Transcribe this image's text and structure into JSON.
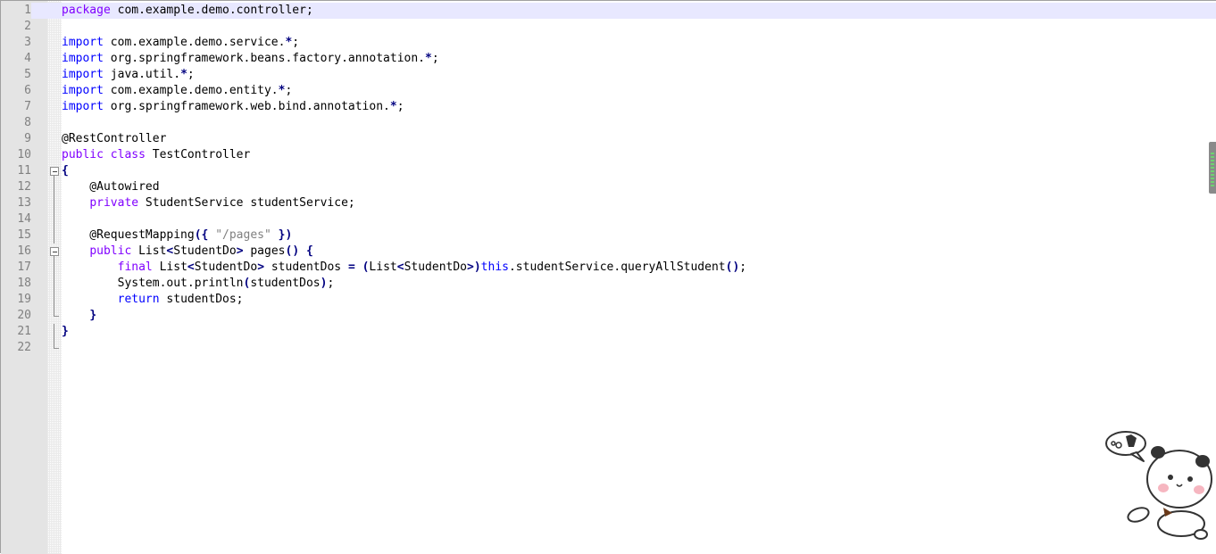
{
  "editor": {
    "lines": [
      {
        "n": "1",
        "tokens": [
          {
            "c": "kw",
            "t": "package"
          },
          {
            "c": "",
            "t": " com.example.demo.controller;"
          }
        ]
      },
      {
        "n": "2",
        "tokens": []
      },
      {
        "n": "3",
        "tokens": [
          {
            "c": "kw2",
            "t": "import"
          },
          {
            "c": "",
            "t": " com.example.demo.service."
          },
          {
            "c": "op",
            "t": "*"
          },
          {
            "c": "",
            "t": ";"
          }
        ]
      },
      {
        "n": "4",
        "tokens": [
          {
            "c": "kw2",
            "t": "import"
          },
          {
            "c": "",
            "t": " org.springframework.beans.factory.annotation."
          },
          {
            "c": "op",
            "t": "*"
          },
          {
            "c": "",
            "t": ";"
          }
        ]
      },
      {
        "n": "5",
        "tokens": [
          {
            "c": "kw2",
            "t": "import"
          },
          {
            "c": "",
            "t": " java.util."
          },
          {
            "c": "op",
            "t": "*"
          },
          {
            "c": "",
            "t": ";"
          }
        ]
      },
      {
        "n": "6",
        "tokens": [
          {
            "c": "kw2",
            "t": "import"
          },
          {
            "c": "",
            "t": " com.example.demo.entity."
          },
          {
            "c": "op",
            "t": "*"
          },
          {
            "c": "",
            "t": ";"
          }
        ]
      },
      {
        "n": "7",
        "tokens": [
          {
            "c": "kw2",
            "t": "import"
          },
          {
            "c": "",
            "t": " org.springframework.web.bind.annotation."
          },
          {
            "c": "op",
            "t": "*"
          },
          {
            "c": "",
            "t": ";"
          }
        ]
      },
      {
        "n": "8",
        "tokens": []
      },
      {
        "n": "9",
        "tokens": [
          {
            "c": "",
            "t": "@RestController"
          }
        ]
      },
      {
        "n": "10",
        "tokens": [
          {
            "c": "kw",
            "t": "public"
          },
          {
            "c": "",
            "t": " "
          },
          {
            "c": "kw",
            "t": "class"
          },
          {
            "c": "",
            "t": " TestController"
          }
        ]
      },
      {
        "n": "11",
        "tokens": [
          {
            "c": "op",
            "t": "{"
          }
        ]
      },
      {
        "n": "12",
        "tokens": [
          {
            "c": "",
            "t": "    @Autowired"
          }
        ]
      },
      {
        "n": "13",
        "tokens": [
          {
            "c": "",
            "t": "    "
          },
          {
            "c": "kw",
            "t": "private"
          },
          {
            "c": "",
            "t": " StudentService studentService;"
          }
        ]
      },
      {
        "n": "14",
        "tokens": []
      },
      {
        "n": "15",
        "tokens": [
          {
            "c": "",
            "t": "    @RequestMapping"
          },
          {
            "c": "op",
            "t": "({"
          },
          {
            "c": "",
            "t": " "
          },
          {
            "c": "str",
            "t": "\"/pages\""
          },
          {
            "c": "",
            "t": " "
          },
          {
            "c": "op",
            "t": "})"
          }
        ]
      },
      {
        "n": "16",
        "tokens": [
          {
            "c": "",
            "t": "    "
          },
          {
            "c": "kw",
            "t": "public"
          },
          {
            "c": "",
            "t": " List"
          },
          {
            "c": "op",
            "t": "<"
          },
          {
            "c": "",
            "t": "StudentDo"
          },
          {
            "c": "op",
            "t": ">"
          },
          {
            "c": "",
            "t": " pages"
          },
          {
            "c": "op",
            "t": "()"
          },
          {
            "c": "",
            "t": " "
          },
          {
            "c": "op",
            "t": "{"
          }
        ]
      },
      {
        "n": "17",
        "tokens": [
          {
            "c": "",
            "t": "        "
          },
          {
            "c": "kw",
            "t": "final"
          },
          {
            "c": "",
            "t": " List"
          },
          {
            "c": "op",
            "t": "<"
          },
          {
            "c": "",
            "t": "StudentDo"
          },
          {
            "c": "op",
            "t": ">"
          },
          {
            "c": "",
            "t": " studentDos "
          },
          {
            "c": "op",
            "t": "="
          },
          {
            "c": "",
            "t": " "
          },
          {
            "c": "op",
            "t": "("
          },
          {
            "c": "",
            "t": "List"
          },
          {
            "c": "op",
            "t": "<"
          },
          {
            "c": "",
            "t": "StudentDo"
          },
          {
            "c": "op",
            "t": ">)"
          },
          {
            "c": "kw2",
            "t": "this"
          },
          {
            "c": "",
            "t": ".studentService.queryAllStudent"
          },
          {
            "c": "op",
            "t": "()"
          },
          {
            "c": "",
            "t": ";"
          }
        ]
      },
      {
        "n": "18",
        "tokens": [
          {
            "c": "",
            "t": "        System.out.println"
          },
          {
            "c": "op",
            "t": "("
          },
          {
            "c": "",
            "t": "studentDos"
          },
          {
            "c": "op",
            "t": ")"
          },
          {
            "c": "",
            "t": ";"
          }
        ]
      },
      {
        "n": "19",
        "tokens": [
          {
            "c": "",
            "t": "        "
          },
          {
            "c": "kw2",
            "t": "return"
          },
          {
            "c": "",
            "t": " studentDos;"
          }
        ]
      },
      {
        "n": "20",
        "tokens": [
          {
            "c": "",
            "t": "    "
          },
          {
            "c": "op",
            "t": "}"
          }
        ]
      },
      {
        "n": "21",
        "tokens": [
          {
            "c": "op",
            "t": "}"
          }
        ]
      },
      {
        "n": "22",
        "tokens": []
      }
    ]
  },
  "colors": {
    "keyword": "#8000ff",
    "keyword_alt": "#0000ff",
    "operator": "#000080",
    "string": "#808080",
    "current_line": "#e8e8ff"
  },
  "icons": {
    "fold_marker": "fold-minus-icon",
    "mascot": "panda-mascot-icon"
  }
}
